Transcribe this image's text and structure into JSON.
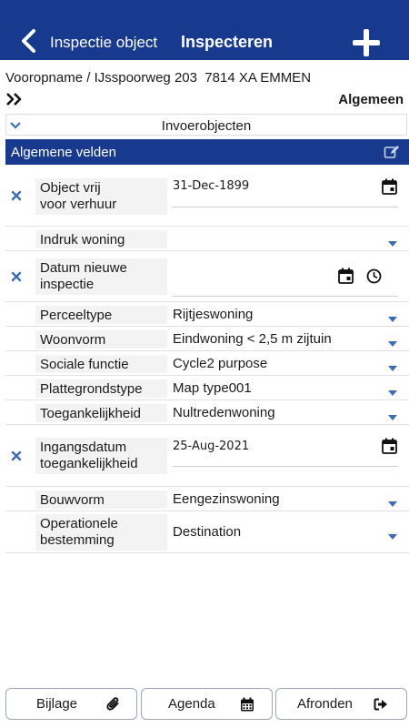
{
  "header": {
    "back_label": "Inspectie object",
    "title": "Inspecteren",
    "bg_color": "#173a8e"
  },
  "subheader": {
    "address": "Vooropname / IJsspoorweg 203  7814 XA EMMEN",
    "section": "Algemeen"
  },
  "invoer": {
    "label": "Invoerobjecten"
  },
  "group": {
    "title": "Algemene velden"
  },
  "fields": {
    "object_vrij": {
      "label_1": "Object vrij",
      "label_2": "voor verhuur",
      "value": "31-Dec-1899"
    },
    "indruk_woning": {
      "label": "Indruk woning",
      "value": ""
    },
    "datum_nieuwe_inspectie": {
      "label_1": "Datum nieuwe",
      "label_2": "inspectie",
      "value": ""
    },
    "perceeltype": {
      "label": "Perceeltype",
      "value": "Rijtjeswoning"
    },
    "woonvorm": {
      "label": "Woonvorm",
      "value": "Eindwoning < 2,5 m zijtuin"
    },
    "sociale_functie": {
      "label": "Sociale functie",
      "value": "Cycle2 purpose"
    },
    "plattegrondstype": {
      "label": "Plattegrondstype",
      "value": "Map type001"
    },
    "toegankelijkheid": {
      "label": "Toegankelijkheid",
      "value": "Nultredenwoning"
    },
    "ingangsdatum": {
      "label_1": "Ingangsdatum",
      "label_2": "toegankelijkheid",
      "value": "25-Aug-2021"
    },
    "bouwvorm": {
      "label": "Bouwvorm",
      "value": "Eengezinswoning"
    },
    "bestemming": {
      "label_1": "Operationele",
      "label_2": "bestemming",
      "value": "Destination"
    }
  },
  "footer": {
    "bijlage": "Bijlage",
    "agenda": "Agenda",
    "afronden": "Afronden"
  },
  "icons": {
    "back": "chevron-left-icon",
    "add": "plus-icon",
    "expand": "double-chevron-right-icon",
    "collapse": "chevron-down-icon",
    "edit": "edit-icon",
    "clear": "close-icon",
    "calendar": "calendar-icon",
    "clock": "clock-icon",
    "dropdown": "caret-down-icon",
    "attach": "paperclip-icon",
    "exit": "sign-out-icon"
  },
  "colors": {
    "primary": "#173a8e",
    "accent": "#3c6bb8"
  }
}
